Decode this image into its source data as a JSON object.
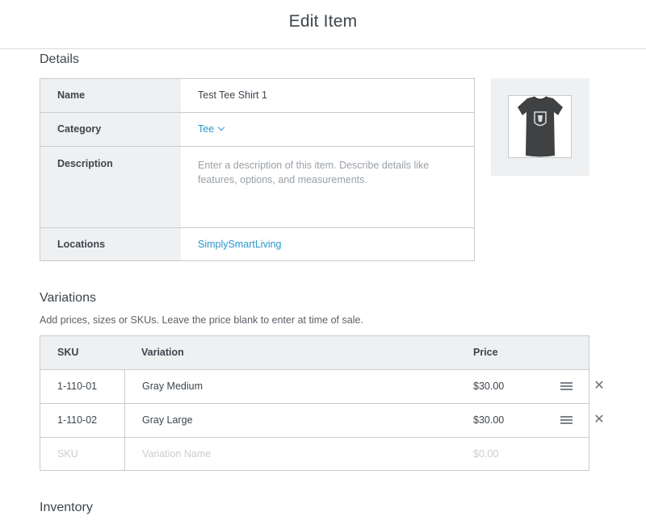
{
  "header": {
    "title": "Edit Item"
  },
  "details": {
    "title": "Details",
    "rows": {
      "name": {
        "label": "Name",
        "value": "Test Tee Shirt 1"
      },
      "category": {
        "label": "Category",
        "value": "Tee"
      },
      "description": {
        "label": "Description",
        "placeholder": "Enter a description of this item. Describe details like features, options, and measurements."
      },
      "locations": {
        "label": "Locations",
        "value": "SimplySmartLiving"
      }
    },
    "image": {
      "alt": "tee-shirt-thumbnail",
      "shirt_color": "#3f4143"
    }
  },
  "variations": {
    "title": "Variations",
    "subtitle": "Add prices, sizes or SKUs. Leave the price blank to enter at time of sale.",
    "columns": {
      "sku": "SKU",
      "variation": "Variation",
      "price": "Price"
    },
    "rows": [
      {
        "sku": "1-110-01",
        "variation": "Gray Medium",
        "price": "$30.00"
      },
      {
        "sku": "1-110-02",
        "variation": "Gray Large",
        "price": "$30.00"
      }
    ],
    "new_row": {
      "sku_placeholder": "SKU",
      "variation_placeholder": "Variation Name",
      "price_placeholder": "$0.00"
    }
  },
  "inventory": {
    "title": "Inventory"
  },
  "colors": {
    "accent": "#2996cc",
    "border": "#c8cbce",
    "label_bg": "#eff0f1"
  }
}
